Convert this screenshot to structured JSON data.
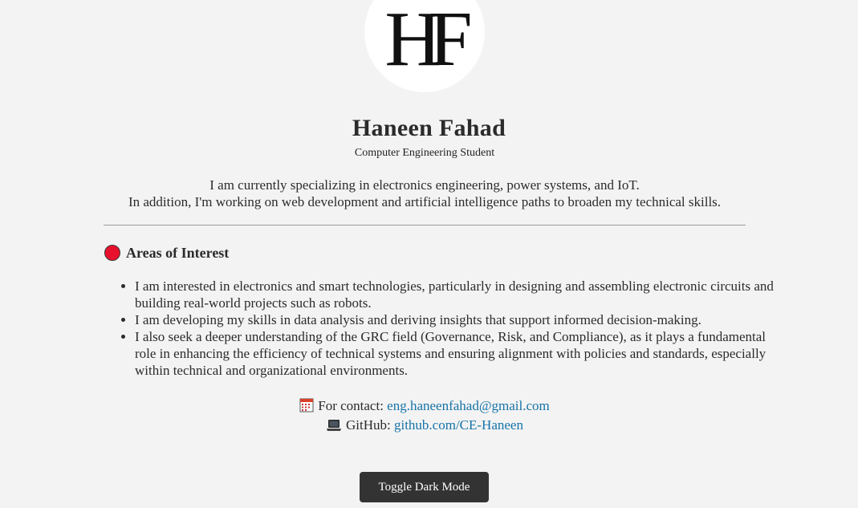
{
  "profile": {
    "logo_text": "HF",
    "name": "Haneen Fahad",
    "subtitle": "Computer Engineering Student",
    "intro_line1": "I am currently specializing in electronics engineering, power systems, and IoT.",
    "intro_line2": "In addition, I'm working on web development and artificial intelligence paths to broaden my technical skills."
  },
  "interests": {
    "icon": "red-circle-icon",
    "title": "Areas of Interest",
    "items": [
      "I am interested in electronics and smart technologies, particularly in designing and assembling electronic circuits and building real-world projects such as robots.",
      "I am developing my skills in data analysis and deriving insights that support informed decision-making.",
      "I also seek a deeper understanding of the GRC field (Governance, Risk, and Compliance), as it plays a fundamental role in enhancing the efficiency of technical systems and ensuring alignment with policies and standards, especially within technical and organizational environments."
    ]
  },
  "contact": {
    "email_icon": "calendar-icon",
    "email_label": "For contact:",
    "email": "eng.haneenfahad@gmail.com",
    "github_icon": "laptop-icon",
    "github_label": "GitHub:",
    "github": "github.com/CE-Haneen"
  },
  "toggle": {
    "label": "Toggle Dark Mode"
  },
  "colors": {
    "background": "#f3f3f3",
    "text": "#2b2b2b",
    "link": "#1673a8",
    "accent_dot": "#e8112d",
    "button_bg": "#333333",
    "button_text": "#ffffff"
  }
}
